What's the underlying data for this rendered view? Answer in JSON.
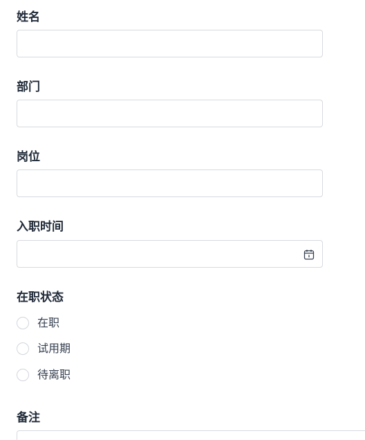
{
  "form": {
    "name_label": "姓名",
    "department_label": "部门",
    "position_label": "岗位",
    "hire_date_label": "入职时间",
    "status_label": "在职状态",
    "status_options": [
      "在职",
      "试用期",
      "待离职"
    ],
    "remarks_label": "备注"
  },
  "icons": {
    "date_picker": "calendar-icon"
  }
}
